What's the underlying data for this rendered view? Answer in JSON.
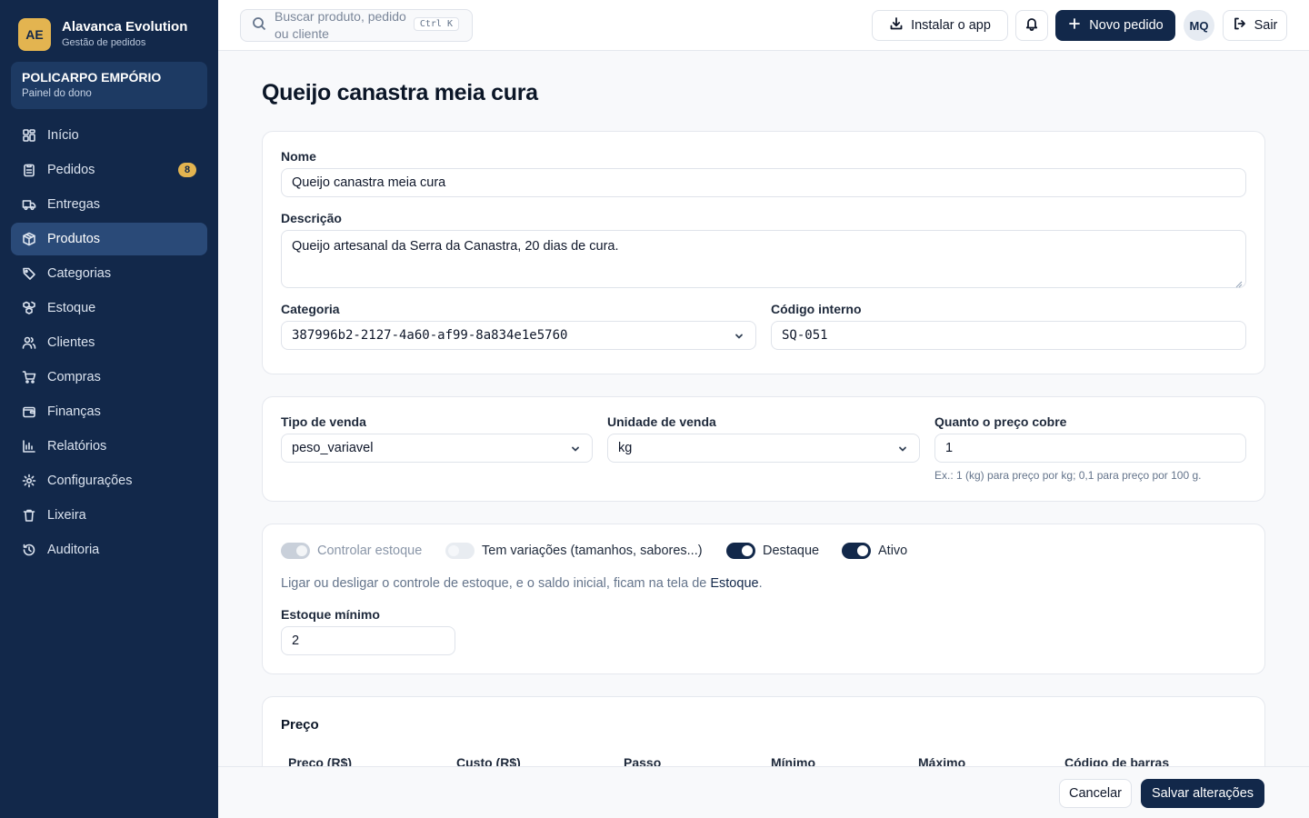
{
  "brand": {
    "badge": "AE",
    "title": "Alavanca Evolution",
    "subtitle": "Gestão de pedidos"
  },
  "store": {
    "name": "POLICARPO EMPÓRIO",
    "subtitle": "Painel do dono"
  },
  "sidebar": {
    "items": [
      {
        "label": "Início",
        "icon": "home-icon"
      },
      {
        "label": "Pedidos",
        "icon": "clipboard-icon",
        "badge": "8"
      },
      {
        "label": "Entregas",
        "icon": "truck-icon"
      },
      {
        "label": "Produtos",
        "icon": "package-icon",
        "active": true
      },
      {
        "label": "Categorias",
        "icon": "tag-icon"
      },
      {
        "label": "Estoque",
        "icon": "boxes-icon"
      },
      {
        "label": "Clientes",
        "icon": "users-icon"
      },
      {
        "label": "Compras",
        "icon": "cart-icon"
      },
      {
        "label": "Finanças",
        "icon": "wallet-icon"
      },
      {
        "label": "Relatórios",
        "icon": "bar-chart-icon"
      },
      {
        "label": "Configurações",
        "icon": "gear-icon"
      },
      {
        "label": "Lixeira",
        "icon": "trash-icon"
      },
      {
        "label": "Auditoria",
        "icon": "history-icon"
      }
    ]
  },
  "topbar": {
    "search_placeholder": "Buscar produto, pedido ou cliente",
    "search_shortcut": "Ctrl K",
    "install_label": "Instalar o app",
    "new_order_label": "Novo pedido",
    "avatar_initials": "MQ",
    "logout_label": "Sair"
  },
  "page": {
    "title": "Queijo canastra meia cura"
  },
  "form": {
    "name_label": "Nome",
    "name_value": "Queijo canastra meia cura",
    "description_label": "Descrição",
    "description_value": "Queijo artesanal da Serra da Canastra, 20 dias de cura.",
    "category_label": "Categoria",
    "category_value": "387996b2-2127-4a60-af99-8a834e1e5760",
    "code_label": "Código interno",
    "code_value": "SQ-051",
    "sale_type_label": "Tipo de venda",
    "sale_type_value": "peso_variavel",
    "sale_unit_label": "Unidade de venda",
    "sale_unit_value": "kg",
    "price_covers_label": "Quanto o preço cobre",
    "price_covers_value": "1",
    "price_covers_hint": "Ex.: 1 (kg) para preço por kg; 0,1 para preço por 100 g."
  },
  "toggles": {
    "stock_control": {
      "label": "Controlar estoque",
      "state": "on-disabled"
    },
    "variations": {
      "label": "Tem variações (tamanhos, sabores...)",
      "state": "off"
    },
    "featured": {
      "label": "Destaque",
      "state": "on"
    },
    "active": {
      "label": "Ativo",
      "state": "on"
    },
    "info_prefix": "Ligar ou desligar o controle de estoque, e o saldo inicial, ficam na tela de ",
    "info_link": "Estoque",
    "info_suffix": ".",
    "min_stock_label": "Estoque mínimo",
    "min_stock_value": "2"
  },
  "price": {
    "title": "Preço",
    "columns": [
      "Preço (R$)",
      "Custo (R$)",
      "Passo",
      "Mínimo",
      "Máximo",
      "Código de barras"
    ]
  },
  "footer": {
    "cancel_label": "Cancelar",
    "save_label": "Salvar alterações"
  },
  "colors": {
    "sidebar": "#12284a",
    "accent": "#e3b450",
    "primary": "#12284a"
  }
}
